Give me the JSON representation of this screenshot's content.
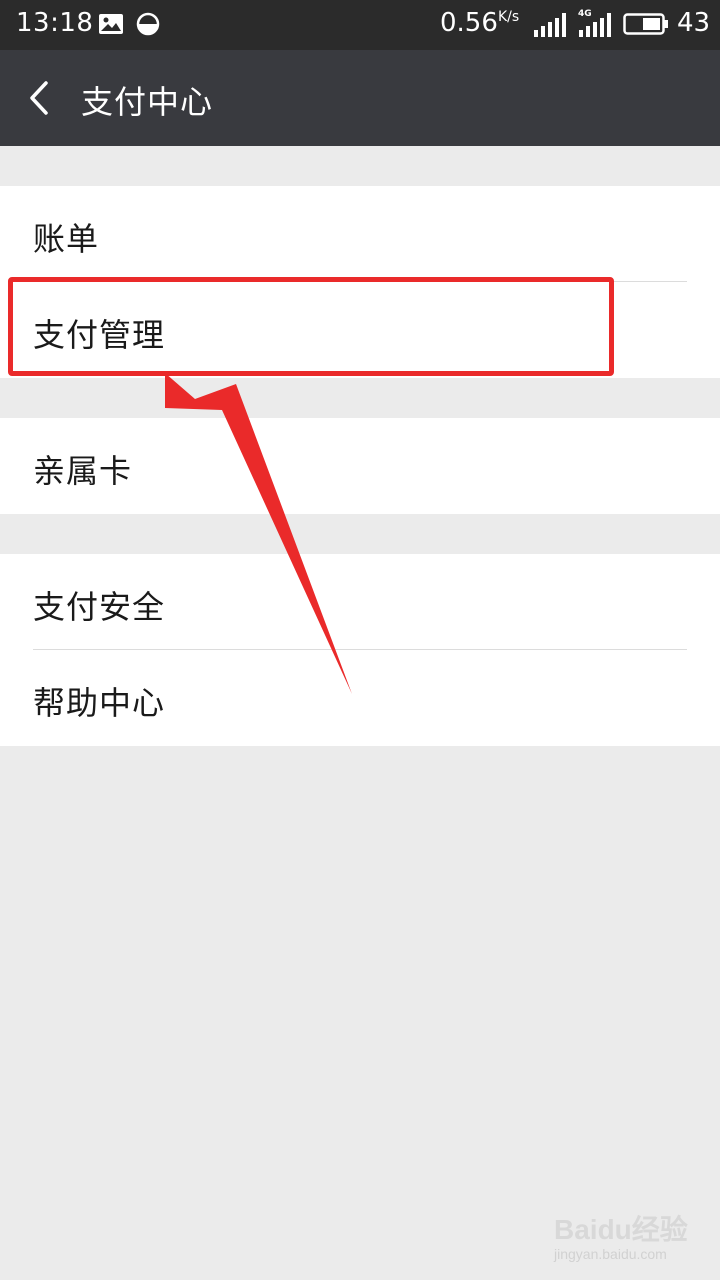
{
  "status_bar": {
    "time": "13:18",
    "speed": "0.56",
    "speed_unit": "K/s",
    "network_type": "4G",
    "battery": "43"
  },
  "header": {
    "title": "支付中心",
    "back_icon": "chevron-left-icon"
  },
  "menu": {
    "group1": [
      {
        "label": "账单"
      },
      {
        "label": "支付管理"
      }
    ],
    "group2": [
      {
        "label": "亲属卡"
      }
    ],
    "group3": [
      {
        "label": "支付安全"
      },
      {
        "label": "帮助中心"
      }
    ]
  },
  "annotation": {
    "color": "#ea2a2a"
  },
  "watermark": {
    "main": "Baidu经验",
    "sub": "jingyan.baidu.com"
  }
}
